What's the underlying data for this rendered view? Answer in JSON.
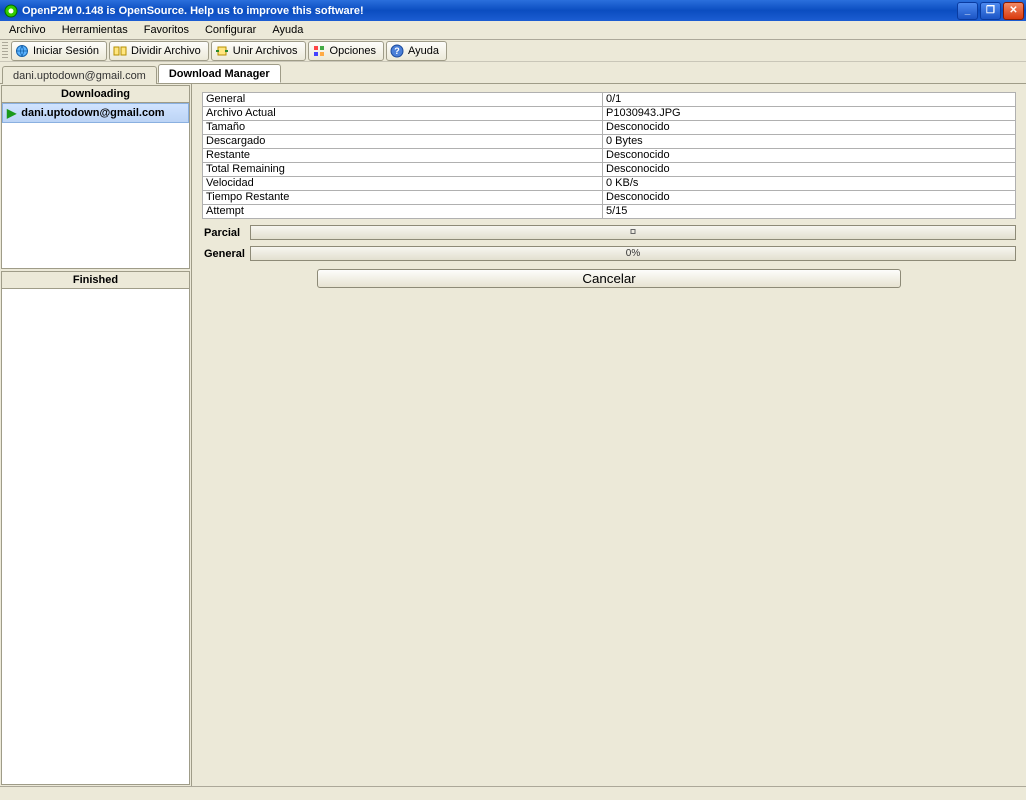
{
  "title": "OpenP2M 0.148 is OpenSource. Help us to improve this software!",
  "menubar": [
    "Archivo",
    "Herramientas",
    "Favoritos",
    "Configurar",
    "Ayuda"
  ],
  "toolbar": [
    {
      "label": "Iniciar Sesión",
      "icon": "globe"
    },
    {
      "label": "Dividir Archivo",
      "icon": "split"
    },
    {
      "label": "Unir Archivos",
      "icon": "join"
    },
    {
      "label": "Opciones",
      "icon": "options"
    },
    {
      "label": "Ayuda",
      "icon": "help"
    }
  ],
  "tabs": [
    {
      "label": "dani.uptodown@gmail.com",
      "active": false
    },
    {
      "label": "Download Manager",
      "active": true
    }
  ],
  "sidebar": {
    "downloading_header": "Downloading",
    "finished_header": "Finished",
    "downloading_items": [
      "dani.uptodown@gmail.com"
    ]
  },
  "info_rows": [
    {
      "k": "General",
      "v": "0/1"
    },
    {
      "k": "Archivo Actual",
      "v": "P1030943.JPG"
    },
    {
      "k": "Tamaño",
      "v": "Desconocido"
    },
    {
      "k": "Descargado",
      "v": "0 Bytes"
    },
    {
      "k": "Restante",
      "v": "Desconocido"
    },
    {
      "k": "Total Remaining",
      "v": "Desconocido"
    },
    {
      "k": "Velocidad",
      "v": "0 KB/s"
    },
    {
      "k": "Tiempo Restante",
      "v": "Desconocido"
    },
    {
      "k": "Attempt",
      "v": "5/15"
    }
  ],
  "progress": {
    "parcial_label": "Parcial",
    "general_label": "General",
    "general_text": "0%"
  },
  "cancel_label": "Cancelar"
}
